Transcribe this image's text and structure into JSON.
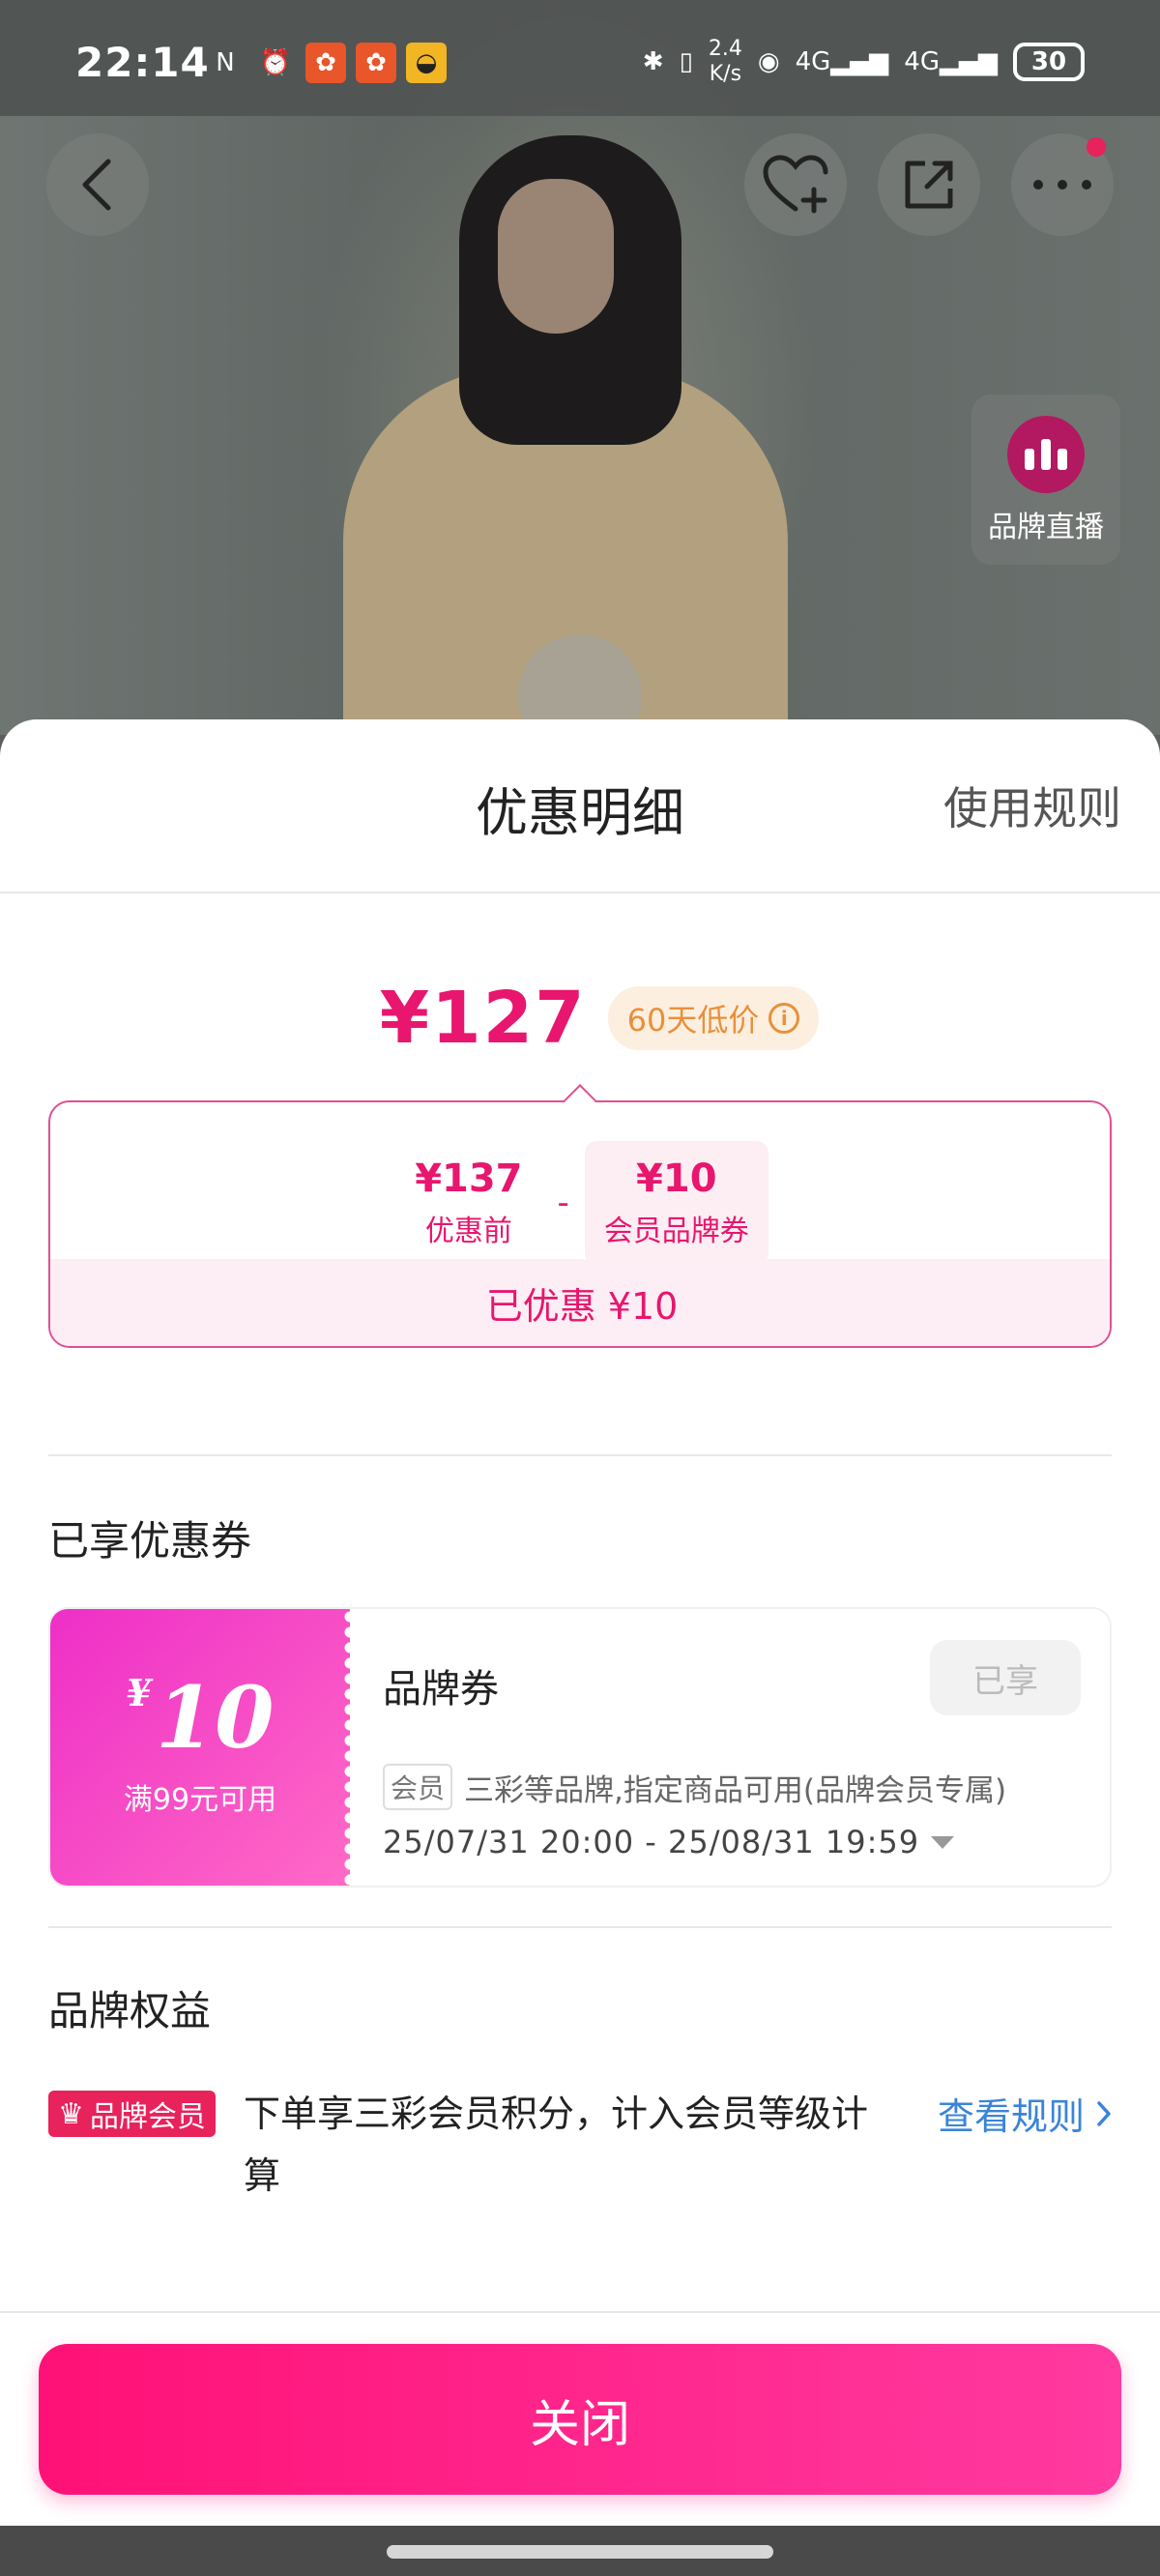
{
  "status_bar": {
    "time": "22:14",
    "net_speed_value": "2.4",
    "net_speed_unit": "K/s",
    "network_1": "4G",
    "network_2": "4G",
    "battery": "30",
    "app_icon_colors": [
      "#e8562a",
      "#e8562a",
      "#f2b524"
    ]
  },
  "product": {
    "live_label": "品牌直播"
  },
  "sheet": {
    "title": "优惠明细",
    "rules_link": "使用规则",
    "final_price": "¥127",
    "low_price_badge": "60天低价",
    "calc": {
      "original_value": "¥137",
      "original_label": "优惠前",
      "operator": "-",
      "discount_value": "¥10",
      "discount_label": "会员品牌券",
      "saved_text": "已优惠 ¥10"
    },
    "coupons_section_title": "已享优惠券",
    "coupon": {
      "currency": "¥",
      "amount": "10",
      "condition": "满99元可用",
      "name": "品牌券",
      "status": "已享",
      "tag": "会员",
      "description": "三彩等品牌,指定商品可用(品牌会员专属)",
      "validity": "25/07/31 20:00 - 25/08/31 19:59"
    },
    "benefits_section_title": "品牌权益",
    "member_badge": "品牌会员",
    "benefit_text": "下单享三彩会员积分，计入会员等级计算",
    "view_rules": "查看规则",
    "close_button": "关闭"
  },
  "colors": {
    "accent": "#e8166e",
    "button": "#ff1177",
    "link": "#3a84d8"
  }
}
